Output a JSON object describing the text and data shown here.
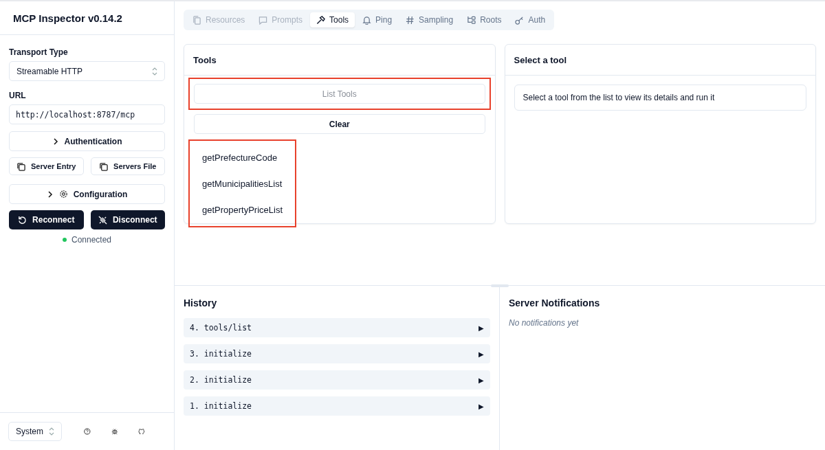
{
  "sidebar": {
    "title": "MCP Inspector v0.14.2",
    "transport": {
      "label": "Transport Type",
      "value": "Streamable HTTP"
    },
    "url": {
      "label": "URL",
      "value": "http://localhost:8787/mcp"
    },
    "authentication": {
      "label": "Authentication",
      "expanded": false
    },
    "copy_buttons": [
      "Server Entry",
      "Servers File"
    ],
    "configuration": {
      "label": "Configuration",
      "expanded": false
    },
    "actions": [
      {
        "kind": "reconnect",
        "label": "Reconnect"
      },
      {
        "kind": "disconnect",
        "label": "Disconnect"
      }
    ],
    "status": {
      "label": "Connected",
      "color": "#22c55e"
    },
    "theme": {
      "value": "System"
    }
  },
  "tabs": [
    {
      "kind": "resources",
      "label": "Resources",
      "selected": false,
      "disabled": true
    },
    {
      "kind": "prompts",
      "label": "Prompts",
      "selected": false,
      "disabled": true
    },
    {
      "kind": "tools",
      "label": "Tools",
      "selected": true,
      "disabled": false
    },
    {
      "kind": "ping",
      "label": "Ping",
      "selected": false,
      "disabled": false
    },
    {
      "kind": "sampling",
      "label": "Sampling",
      "selected": false,
      "disabled": false
    },
    {
      "kind": "roots",
      "label": "Roots",
      "selected": false,
      "disabled": false
    },
    {
      "kind": "auth",
      "label": "Auth",
      "selected": false,
      "disabled": false
    }
  ],
  "tools_panel": {
    "title": "Tools",
    "list_button": {
      "label": "List Tools",
      "disabled": true,
      "highlighted": true
    },
    "clear_button": "Clear",
    "tools_highlighted": true,
    "tools": [
      {
        "name": "getPrefectureCode",
        "selected": false
      },
      {
        "name": "getMunicipalitiesList",
        "selected": false
      },
      {
        "name": "getPropertyPriceList",
        "selected": false
      }
    ]
  },
  "detail_panel": {
    "title": "Select a tool",
    "message": "Select a tool from the list to view its details and run it"
  },
  "history": {
    "title": "History",
    "entries": [
      {
        "label": "4. tools/list",
        "toggle": "▶",
        "expanded": false
      },
      {
        "label": "3. initialize",
        "toggle": "▶",
        "expanded": false
      },
      {
        "label": "2. initialize",
        "toggle": "▶",
        "expanded": false
      },
      {
        "label": "1. initialize",
        "toggle": "▶",
        "expanded": false
      }
    ]
  },
  "notifications": {
    "title": "Server Notifications",
    "empty_text": "No notifications yet"
  }
}
